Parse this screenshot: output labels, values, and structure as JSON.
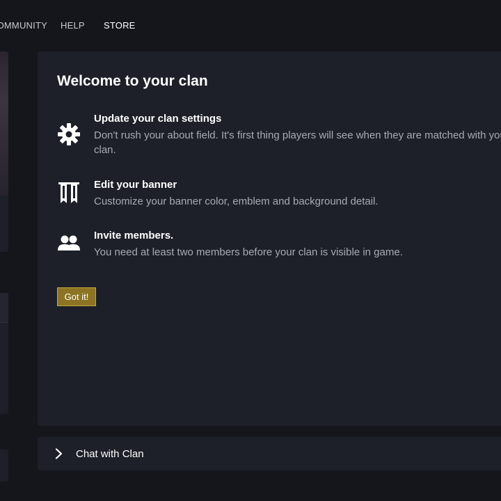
{
  "nav": {
    "items": [
      {
        "label": "COMMUNITY",
        "active": false
      },
      {
        "label": "HELP",
        "active": false
      },
      {
        "label": "STORE",
        "active": true
      }
    ]
  },
  "welcome": {
    "title": "Welcome to your clan",
    "tips": [
      {
        "icon": "gear-icon",
        "title": "Update your clan settings",
        "description": "Don't rush your about field. It's first thing players will see when they are matched with your clan."
      },
      {
        "icon": "banner-icon",
        "title": "Edit your banner",
        "description": "Customize your banner color, emblem and background detail."
      },
      {
        "icon": "members-icon",
        "title": "Invite members.",
        "description": "You need at least two members before your clan is visible in game."
      }
    ],
    "button_label": "Got it!"
  },
  "chat": {
    "icon": "chevron-right-icon",
    "label": "Chat with Clan"
  },
  "colors": {
    "background": "#14161c",
    "card": "#1d2029",
    "accent_gold": "#8d7424",
    "muted_text": "#a7abb3"
  }
}
